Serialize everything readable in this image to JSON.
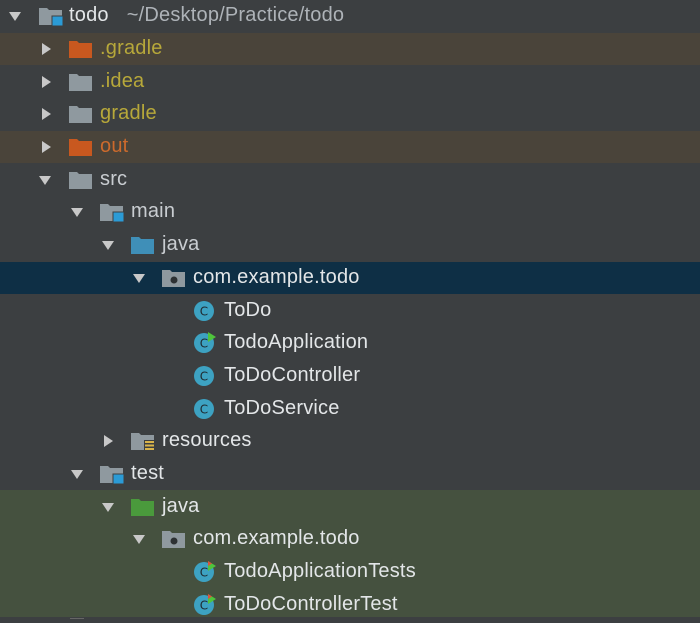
{
  "root": {
    "name": "todo",
    "path": "~/Desktop/Practice/todo"
  },
  "nodes": {
    "gradle_hidden": ".gradle",
    "idea": ".idea",
    "gradle": "gradle",
    "out": "out",
    "src": "src",
    "main": "main",
    "main_java": "java",
    "main_package": "com.example.todo",
    "cls_todo": "ToDo",
    "cls_todo_app": "TodoApplication",
    "cls_todo_controller": "ToDoController",
    "cls_todo_service": "ToDoService",
    "resources": "resources",
    "test": "test",
    "test_java": "java",
    "test_package": "com.example.todo",
    "cls_todo_app_tests": "TodoApplicationTests",
    "cls_todo_controller_test": "ToDoControllerTest"
  },
  "colors": {
    "background": "#3c3f41",
    "selected_row": "#0e2f45",
    "excluded_row": "#4a443a",
    "test_row": "#45513f",
    "folder_gray": "#8f999f",
    "folder_orange": "#c8581f",
    "folder_blue": "#3f8fb8",
    "folder_green": "#4a9a3c",
    "class_teal": "#3da2c2"
  },
  "icons": {
    "folder": "folder-icon",
    "module_folder": "module-folder-icon",
    "package": "package-icon",
    "class": "class-icon",
    "run_class": "runnable-class-icon",
    "test_class": "test-class-icon"
  }
}
